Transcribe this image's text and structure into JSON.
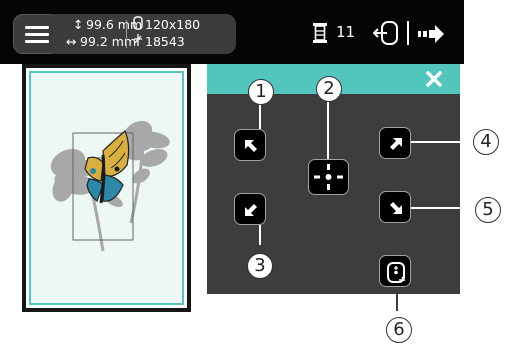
{
  "topbar": {
    "height_value": "99.6 mm",
    "width_value": "99.2 mm",
    "hoop_size": "120x180",
    "stitch_count": "18543",
    "needle_count": "11"
  },
  "icons": {
    "menu": "hamburger-menu-icon",
    "height": "vertical-arrows-icon",
    "width": "horizontal-arrows-icon",
    "hoop": "hoop-icon",
    "stitches": "stitch-icon",
    "spool": "spool-icon",
    "hoop_exit": "hoop-exit-icon",
    "next": "next-arrow-icon",
    "close": "close-icon"
  },
  "panel": {
    "buttons": [
      {
        "id": "up-left",
        "icon": "arrow-up-left-icon"
      },
      {
        "id": "down-left",
        "icon": "arrow-down-left-icon"
      },
      {
        "id": "center",
        "icon": "crosshair-center-icon"
      },
      {
        "id": "up-right",
        "icon": "arrow-up-right-icon"
      },
      {
        "id": "down-right",
        "icon": "arrow-down-right-icon"
      },
      {
        "id": "rotate",
        "icon": "rotate-frame-icon"
      }
    ]
  },
  "callouts": [
    "1",
    "2",
    "3",
    "4",
    "5",
    "6"
  ],
  "colors": {
    "accent": "#52c6bd",
    "panel": "#3d3d3d",
    "topbar": "#050505",
    "canvas_bg": "#edf8f5"
  }
}
